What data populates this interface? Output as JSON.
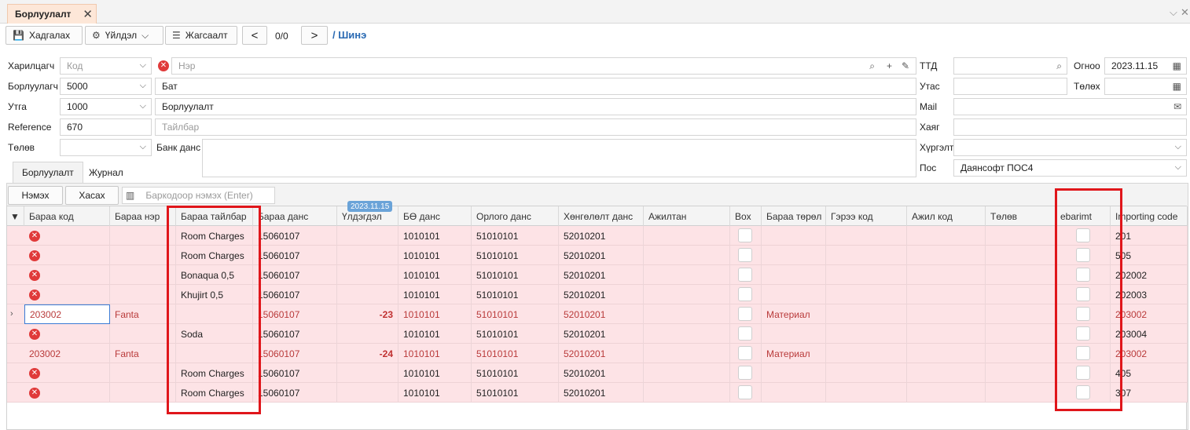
{
  "tab": {
    "title": "Борлуулалт",
    "close": "✕"
  },
  "window": {
    "chevron": "⌵",
    "close": "✕"
  },
  "toolbar": {
    "save": "Хадгалах",
    "action": "Үйлдэл",
    "list": "Жагсаалт",
    "prev": "<",
    "next": ">",
    "counter": "0/0",
    "breadcrumb": "/ Шинэ"
  },
  "form": {
    "customer_label": "Харилцагч",
    "customer_code_placeholder": "Код",
    "customer_name_placeholder": "Нэр",
    "seller_label": "Борлуулагч",
    "seller_code": "5000",
    "seller_name": "Бат",
    "flow_label": "Утга",
    "flow_code": "1000",
    "flow_name": "Борлуулалт",
    "reference_label": "Reference",
    "reference_value": "670",
    "description_placeholder": "Тайлбар",
    "status_label": "Төлөв",
    "bank_label": "Банк данс",
    "ttd_label": "ТТД",
    "phone_label": "Утас",
    "mail_label": "Mail",
    "address_label": "Хаяг",
    "delivery_label": "Хүргэлт",
    "pos_label": "Пос",
    "pos_value": "Даянсофт ПОС4",
    "date_label": "Огноо",
    "date_value": "2023.11.15",
    "pay_label": "Төлөх"
  },
  "subtabs": [
    "Борлуулалт",
    "Журнал"
  ],
  "grid_toolbar": {
    "add": "Нэмэх",
    "remove": "Хасах",
    "barcode_placeholder": "Баркодоор нэмэх (Enter)"
  },
  "date_badge": "2023.11.15",
  "columns": [
    "Бараа код",
    "Бараа нэр",
    "Бараа тайлбар",
    "Бараа данс",
    "Үлдэгдэл",
    "БӨ данс",
    "Орлого данс",
    "Хөнгөлөлт данс",
    "Ажилтан",
    "Box",
    "Бараа төрөл",
    "Гэрээ код",
    "Ажил код",
    "Төлөв",
    "ebarimt",
    "Importing code"
  ],
  "rows": [
    {
      "code": "",
      "name": "",
      "desc": "Room Charges",
      "acct": "15060107",
      "bal": "",
      "bo": "1010101",
      "income": "51010101",
      "disc": "52010201",
      "type": "",
      "imp": "201",
      "err": true,
      "red": false
    },
    {
      "code": "",
      "name": "",
      "desc": "Room Charges",
      "acct": "15060107",
      "bal": "",
      "bo": "1010101",
      "income": "51010101",
      "disc": "52010201",
      "type": "",
      "imp": "505",
      "err": true,
      "red": false
    },
    {
      "code": "",
      "name": "",
      "desc": "Bonaqua 0,5",
      "acct": "15060107",
      "bal": "",
      "bo": "1010101",
      "income": "51010101",
      "disc": "52010201",
      "type": "",
      "imp": "202002",
      "err": true,
      "red": false
    },
    {
      "code": "",
      "name": "",
      "desc": "Khujirt 0,5",
      "acct": "15060107",
      "bal": "",
      "bo": "1010101",
      "income": "51010101",
      "disc": "52010201",
      "type": "",
      "imp": "202003",
      "err": true,
      "red": false
    },
    {
      "code": "203002",
      "name": "Fanta",
      "desc": "",
      "acct": "15060107",
      "bal": "-23",
      "bo": "1010101",
      "income": "51010101",
      "disc": "52010201",
      "type": "Материал",
      "imp": "203002",
      "err": false,
      "red": true
    },
    {
      "code": "",
      "name": "",
      "desc": "Soda",
      "acct": "15060107",
      "bal": "",
      "bo": "1010101",
      "income": "51010101",
      "disc": "52010201",
      "type": "",
      "imp": "203004",
      "err": true,
      "red": false
    },
    {
      "code": "203002",
      "name": "Fanta",
      "desc": "",
      "acct": "15060107",
      "bal": "-24",
      "bo": "1010101",
      "income": "51010101",
      "disc": "52010201",
      "type": "Материал",
      "imp": "203002",
      "err": false,
      "red": true
    },
    {
      "code": "",
      "name": "",
      "desc": "Room Charges",
      "acct": "15060107",
      "bal": "",
      "bo": "1010101",
      "income": "51010101",
      "disc": "52010201",
      "type": "",
      "imp": "405",
      "err": true,
      "red": false
    },
    {
      "code": "",
      "name": "",
      "desc": "Room Charges",
      "acct": "15060107",
      "bal": "",
      "bo": "1010101",
      "income": "51010101",
      "disc": "52010201",
      "type": "",
      "imp": "307",
      "err": true,
      "red": false
    }
  ],
  "colors": {
    "row_bg": "#fde3e6",
    "accent": "#2a6ab3",
    "error": "#e03a3a",
    "highlight": "#e0161b"
  }
}
